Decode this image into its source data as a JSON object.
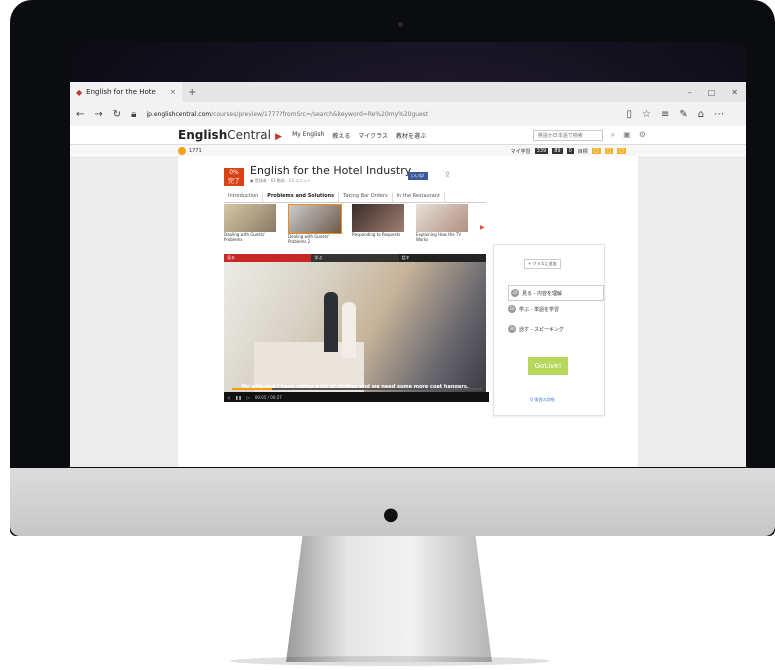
{
  "browser": {
    "tab_title": "English for the Hote",
    "tab_close": "×",
    "new_tab": "+",
    "address_domain": "jp.englishcentral.com",
    "address_path": "/courses/preview/1777?fromSrc=/search&keyword=Re%20my%20guest",
    "window_min": "–",
    "window_max": "□",
    "window_close": "✕"
  },
  "site": {
    "logo_bold": "English",
    "logo_light": "Central",
    "menu": [
      "My English",
      "教える",
      "マイクラス",
      "教材を選ぶ"
    ],
    "search_placeholder": "英語か日本語で検索",
    "points": "1771",
    "my_points_label": "マイ学習",
    "count_1": "339",
    "count_2": "89",
    "count_3": "0",
    "goal_label": "目標"
  },
  "course": {
    "percent": "0%",
    "percent_sub": "完了",
    "title": "English for the Hotel Industry",
    "meta": "● 登録者 · 63 動画 · 13 ユニット",
    "like_label": "いいね!",
    "tabs": [
      "Introduction",
      "Problems and Solutions",
      "Taking Bar Orders",
      "In the Restaurant"
    ],
    "videos": [
      {
        "label": "Dealing with Guests' Problems"
      },
      {
        "label": "Dealing with Guests' Problems 2"
      },
      {
        "label": "Responding to Requests"
      },
      {
        "label": "Explaining How the TV Works"
      }
    ]
  },
  "player": {
    "tab_watch": "見る",
    "tab_learn": "学ぶ",
    "tab_speak": "話す",
    "caption_main": "My wife and I have rather a lot of clothes and we need some more ",
    "caption_word": "coat hangers.",
    "time": "00:05 / 00:27",
    "progress": 0.16
  },
  "side": {
    "add_class": "+ クラスに追加",
    "steps": [
      {
        "num": "20",
        "label": "見る - 内容を理解"
      },
      {
        "num": "20",
        "label": "学ぶ - 単語を学習"
      },
      {
        "num": "30",
        "label": "話す - スピーキング"
      }
    ],
    "go_live": "GoLive!",
    "review_link": "Q 復習の詳細"
  }
}
